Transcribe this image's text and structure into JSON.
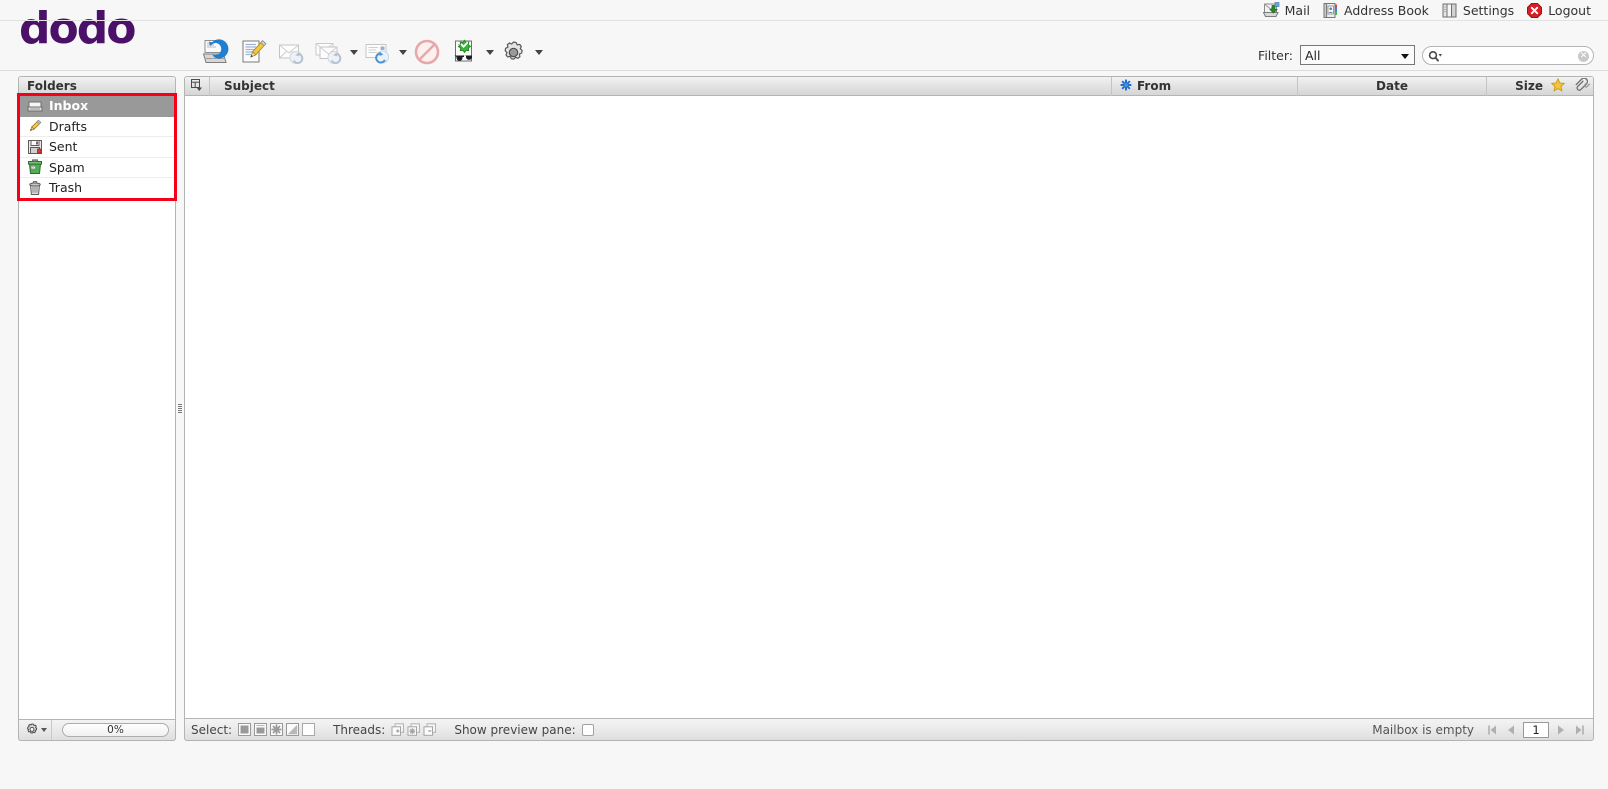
{
  "app": {
    "logo_text": "dodo",
    "brand_color": "#4b1168",
    "highlight_color": "#f4001b"
  },
  "taskbar": {
    "items": [
      {
        "label": "Mail",
        "icon": "mail-icon"
      },
      {
        "label": "Address Book",
        "icon": "address-book-icon"
      },
      {
        "label": "Settings",
        "icon": "settings-icon"
      },
      {
        "label": "Logout",
        "icon": "logout-icon"
      }
    ]
  },
  "toolbar": {
    "buttons": [
      {
        "name": "check-mail-button",
        "icon": "refresh-inbox-icon",
        "has_arrow": false
      },
      {
        "name": "compose-button",
        "icon": "compose-pencil-icon",
        "has_arrow": false
      },
      {
        "name": "reply-button",
        "icon": "reply-envelope-icon",
        "has_arrow": false
      },
      {
        "name": "reply-all-button",
        "icon": "reply-all-envelope-icon",
        "has_arrow": true
      },
      {
        "name": "forward-button",
        "icon": "forward-envelope-icon",
        "has_arrow": true
      },
      {
        "name": "delete-button",
        "icon": "delete-prohibited-icon",
        "has_arrow": false
      },
      {
        "name": "mark-button",
        "icon": "mark-read-glasses-icon",
        "has_arrow": true
      },
      {
        "name": "more-actions-button",
        "icon": "gear-icon",
        "has_arrow": true
      }
    ]
  },
  "search": {
    "filter_label": "Filter:",
    "filter_value": "All",
    "filter_options": [
      "All"
    ],
    "input_value": "",
    "placeholder": ""
  },
  "folders": {
    "header": "Folders",
    "items": [
      {
        "label": "Inbox",
        "icon": "inbox-tray-icon",
        "selected": true
      },
      {
        "label": "Drafts",
        "icon": "pencil-icon",
        "selected": false
      },
      {
        "label": "Sent",
        "icon": "sent-disk-icon",
        "selected": false
      },
      {
        "label": "Spam",
        "icon": "spam-bin-icon",
        "selected": false
      },
      {
        "label": "Trash",
        "icon": "trash-can-icon",
        "selected": false
      }
    ],
    "footer": {
      "gear_icon": "gear-icon",
      "quota_text": "0%"
    }
  },
  "messagelist": {
    "columns": {
      "threads_icon": "thread-toggle-icon",
      "subject": "Subject",
      "from": "From",
      "from_icon": "sort-asterisk-icon",
      "date": "Date",
      "size": "Size",
      "flag_icon": "star-flag-icon",
      "attachment_icon": "paperclip-icon"
    },
    "rows": []
  },
  "statusbar": {
    "select_label": "Select:",
    "select_buttons": [
      {
        "name": "select-all-button",
        "icon": "select-all-icon"
      },
      {
        "name": "select-page-button",
        "icon": "select-page-icon"
      },
      {
        "name": "select-unread-button",
        "icon": "select-unread-icon"
      },
      {
        "name": "select-invert-button",
        "icon": "select-invert-icon"
      },
      {
        "name": "select-none-button",
        "icon": "select-none-icon"
      }
    ],
    "threads_label": "Threads:",
    "thread_buttons": [
      {
        "name": "expand-all-button",
        "icon": "expand-all-icon"
      },
      {
        "name": "expand-unread-button",
        "icon": "expand-unread-icon"
      },
      {
        "name": "collapse-all-button",
        "icon": "collapse-all-icon"
      }
    ],
    "preview_label": "Show preview pane:",
    "preview_checked": false,
    "message_count": "Mailbox is empty",
    "page_value": "1",
    "pager": [
      {
        "name": "first-page-button",
        "icon": "first-page-icon",
        "enabled": false
      },
      {
        "name": "prev-page-button",
        "icon": "prev-page-icon",
        "enabled": false
      },
      {
        "name": "next-page-button",
        "icon": "next-page-icon",
        "enabled": false
      },
      {
        "name": "last-page-button",
        "icon": "last-page-icon",
        "enabled": false
      }
    ]
  }
}
